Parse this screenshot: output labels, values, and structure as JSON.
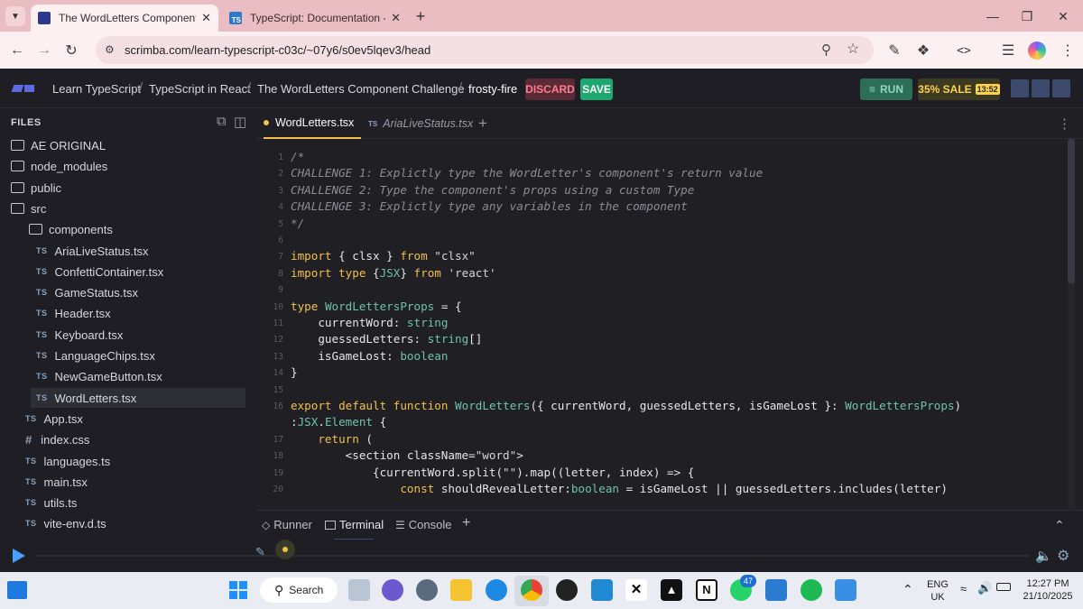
{
  "browser": {
    "tabs": [
      {
        "title": "The WordLetters Component C",
        "active": true
      },
      {
        "title": "TypeScript: Documentation - U",
        "active": false
      }
    ],
    "url": "scrimba.com/learn-typescript-c03c/~07y6/s0ev5lqev3/head"
  },
  "header": {
    "breadcrumbs": [
      "Learn TypeScript",
      "TypeScript in React",
      "The WordLetters Component Challenge",
      "frosty-fire"
    ],
    "discard_label": "DISCARD",
    "save_label": "SAVE",
    "run_label": "RUN",
    "sale_label": "35% SALE",
    "sale_timer": "13:52"
  },
  "sidebar": {
    "title": "FILES",
    "items": [
      {
        "label": "AE ORIGINAL",
        "kind": "folder"
      },
      {
        "label": "node_modules",
        "kind": "folder"
      },
      {
        "label": "public",
        "kind": "folder"
      },
      {
        "label": "src",
        "kind": "folder-open"
      },
      {
        "label": "components",
        "kind": "folder-open"
      },
      {
        "label": "AriaLiveStatus.tsx",
        "kind": "ts"
      },
      {
        "label": "ConfettiContainer.tsx",
        "kind": "ts"
      },
      {
        "label": "GameStatus.tsx",
        "kind": "ts"
      },
      {
        "label": "Header.tsx",
        "kind": "ts"
      },
      {
        "label": "Keyboard.tsx",
        "kind": "ts"
      },
      {
        "label": "LanguageChips.tsx",
        "kind": "ts"
      },
      {
        "label": "NewGameButton.tsx",
        "kind": "ts"
      },
      {
        "label": "WordLetters.tsx",
        "kind": "ts",
        "selected": true
      },
      {
        "label": "App.tsx",
        "kind": "ts"
      },
      {
        "label": "index.css",
        "kind": "css"
      },
      {
        "label": "languages.ts",
        "kind": "ts"
      },
      {
        "label": "main.tsx",
        "kind": "ts"
      },
      {
        "label": "utils.ts",
        "kind": "ts"
      },
      {
        "label": "vite-env.d.ts",
        "kind": "ts"
      }
    ],
    "ts_badge": "TS",
    "css_badge": "#"
  },
  "editor": {
    "tabs": [
      {
        "label": "WordLetters.tsx",
        "active": true
      },
      {
        "label": "AriaLiveStatus.tsx",
        "active": false
      }
    ],
    "lines": [
      {
        "n": "1",
        "code": "/*"
      },
      {
        "n": "2",
        "code": "CHALLENGE 1: Explictly type the WordLetter's component's return value"
      },
      {
        "n": "3",
        "code": "CHALLENGE 2: Type the component's props using a custom Type"
      },
      {
        "n": "4",
        "code": "CHALLENGE 3: Explictly type any variables in the component"
      },
      {
        "n": "5",
        "code": "*/"
      },
      {
        "n": "6",
        "code": ""
      },
      {
        "n": "7",
        "code": "import { clsx } from \"clsx\""
      },
      {
        "n": "8",
        "code": "import type {JSX} from 'react'"
      },
      {
        "n": "9",
        "code": ""
      },
      {
        "n": "10",
        "code": "type WordLettersProps = {"
      },
      {
        "n": "11",
        "code": "    currentWord: string"
      },
      {
        "n": "12",
        "code": "    guessedLetters: string[]"
      },
      {
        "n": "13",
        "code": "    isGameLost: boolean"
      },
      {
        "n": "14",
        "code": "}"
      },
      {
        "n": "15",
        "code": ""
      },
      {
        "n": "16",
        "code": "export default function WordLetters({ currentWord, guessedLetters, isGameLost }: WordLettersProps)"
      },
      {
        "n": "",
        "code": ":JSX.Element {"
      },
      {
        "n": "17",
        "code": "    return ("
      },
      {
        "n": "18",
        "code": "        <section className=\"word\">"
      },
      {
        "n": "19",
        "code": "            {currentWord.split(\"\").map((letter, index) => {"
      },
      {
        "n": "20",
        "code": "                const shouldRevealLetter:boolean = isGameLost || guessedLetters.includes(letter)"
      }
    ]
  },
  "panel": {
    "tabs": [
      "Runner",
      "Terminal",
      "Console"
    ],
    "active": "Terminal"
  },
  "taskbar": {
    "search_label": "Search",
    "lang": "ENG",
    "region": "UK",
    "time": "12:27 PM",
    "date": "21/10/2025",
    "whatsapp_badge": "47"
  }
}
